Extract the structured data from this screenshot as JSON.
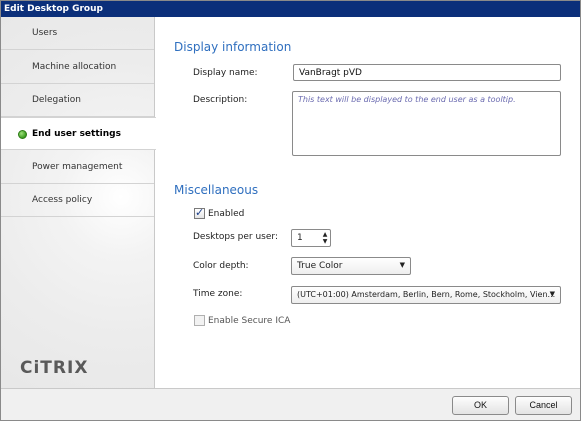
{
  "window": {
    "title": "Edit Desktop Group"
  },
  "sidebar": {
    "items": [
      {
        "label": "Users"
      },
      {
        "label": "Machine allocation"
      },
      {
        "label": "Delegation"
      },
      {
        "label": "End user settings"
      },
      {
        "label": "Power management"
      },
      {
        "label": "Access policy"
      }
    ],
    "active_index": 3,
    "logo": "CiTRIX"
  },
  "display_info": {
    "title": "Display information",
    "display_name_label": "Display name:",
    "display_name_value": "VanBragt pVD",
    "description_label": "Description:",
    "description_placeholder": "This text will be displayed to the end user as a tooltip."
  },
  "misc": {
    "title": "Miscellaneous",
    "enabled_label": "Enabled",
    "enabled_checked": true,
    "desktops_label": "Desktops per user:",
    "desktops_value": "1",
    "color_depth_label": "Color depth:",
    "color_depth_value": "True Color",
    "time_zone_label": "Time zone:",
    "time_zone_value": "(UTC+01:00) Amsterdam, Berlin, Bern, Rome, Stockholm, Vien...",
    "secure_ica_label": "Enable Secure ICA",
    "secure_ica_checked": false
  },
  "footer": {
    "ok_label": "OK",
    "cancel_label": "Cancel"
  },
  "colors": {
    "titlebar": "#0b2f7a",
    "section_title": "#2f6fbf",
    "active_dot": "#3b9b1f"
  }
}
